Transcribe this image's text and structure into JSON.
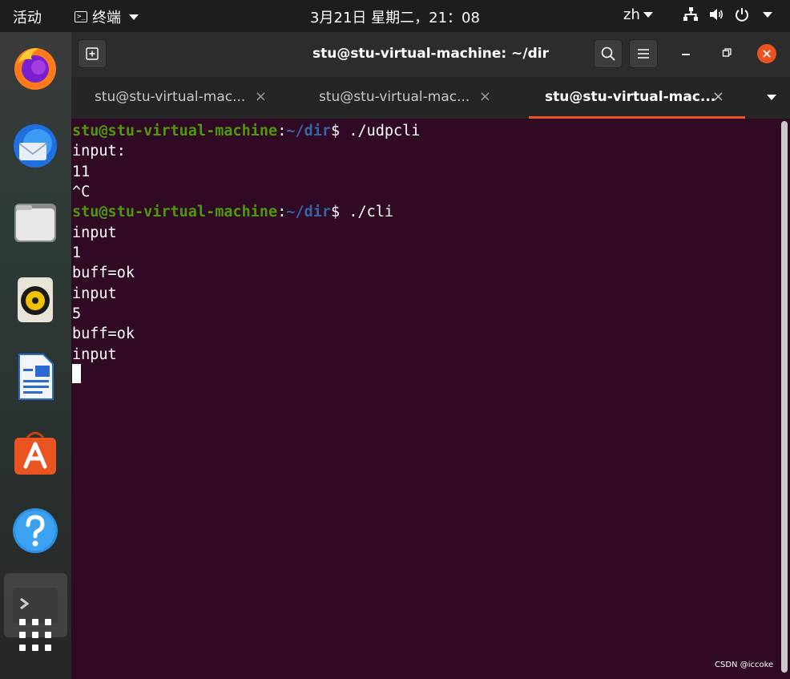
{
  "topbar": {
    "activities": "活动",
    "app_menu": "终端",
    "clock": "3月21日 星期二，21：08",
    "language": "zh"
  },
  "dock": {
    "items": [
      "firefox-icon",
      "thunderbird-icon",
      "files-icon",
      "rhythmbox-icon",
      "writer-icon",
      "software-icon",
      "help-icon",
      "terminal-icon",
      "app-grid-icon"
    ]
  },
  "window": {
    "title": "stu@stu-virtual-machine: ~/dir",
    "tabs": [
      {
        "label": "stu@stu-virtual-mac...",
        "active": false
      },
      {
        "label": "stu@stu-virtual-mac...",
        "active": false
      },
      {
        "label": "stu@stu-virtual-mac...",
        "active": true
      }
    ],
    "tab_close_glyph": "×"
  },
  "terminal": {
    "prompt1": {
      "user": "stu@stu-virtual-machine",
      "sep": ":",
      "path": "~/dir",
      "end": "$ ",
      "cmd": "./udpcli"
    },
    "prompt2": {
      "user": "stu@stu-virtual-machine",
      "sep": ":",
      "path": "~/dir",
      "end": "$ ",
      "cmd": "./cli"
    },
    "lines": [
      "input:",
      "11",
      "^C",
      "input",
      "1",
      "buff=ok",
      "input",
      "5",
      "buff=ok",
      "input"
    ]
  },
  "colors": {
    "accent": "#e95420",
    "terminal_bg": "#300a24",
    "prompt_user": "#4e9a06",
    "prompt_path": "#3465a4"
  },
  "watermark": "CSDN @iccoke"
}
